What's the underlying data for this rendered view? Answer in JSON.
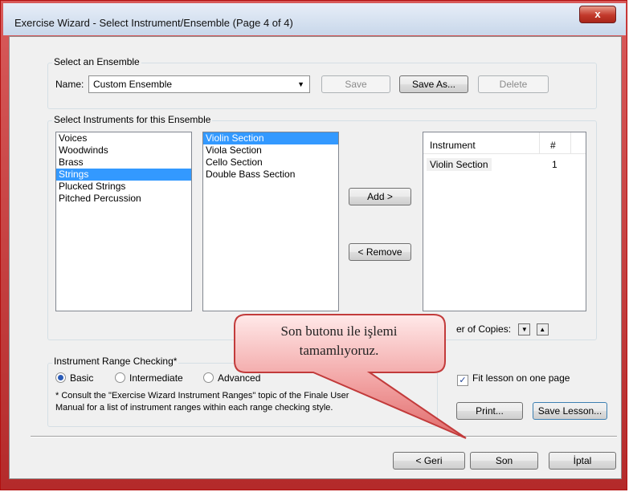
{
  "window": {
    "title": "Exercise Wizard - Select Instrument/Ensemble (Page 4 of 4)",
    "close_glyph": "x"
  },
  "ensemble": {
    "group_label": "Select an Ensemble",
    "name_label": "Name:",
    "name_value": "Custom Ensemble",
    "save": "Save",
    "save_as": "Save As...",
    "delete": "Delete"
  },
  "instruments": {
    "group_label": "Select Instruments for this Ensemble",
    "families": [
      "Voices",
      "Woodwinds",
      "Brass",
      "Strings",
      "Plucked Strings",
      "Pitched Percussion"
    ],
    "selected_family": "Strings",
    "sections": [
      "Violin Section",
      "Viola Section",
      "Cello Section",
      "Double Bass Section"
    ],
    "selected_section": "Violin Section",
    "add": "Add >",
    "remove": "< Remove",
    "table_headers": [
      "Instrument",
      "#"
    ],
    "table_rows": [
      [
        "Violin Section",
        "1"
      ]
    ],
    "copies_label": "er of Copies:"
  },
  "range": {
    "group_label": "Instrument Range Checking*",
    "options": [
      "Basic",
      "Intermediate",
      "Advanced"
    ],
    "selected": "Basic",
    "note_line1": "* Consult the \"Exercise Wizard Instrument Ranges\" topic of the Finale User",
    "note_line2": "Manual for a list of instrument ranges within each range checking style."
  },
  "lesson": {
    "fit_label": "Fit lesson on one page",
    "fit_checked": true,
    "print": "Print...",
    "save_lesson": "Save Lesson..."
  },
  "footer": {
    "back": "< Geri",
    "finish": "Son",
    "cancel": "İptal"
  },
  "callout": {
    "line1": "Son butonu ile işlemi",
    "line2": "tamamlıyoruz."
  }
}
